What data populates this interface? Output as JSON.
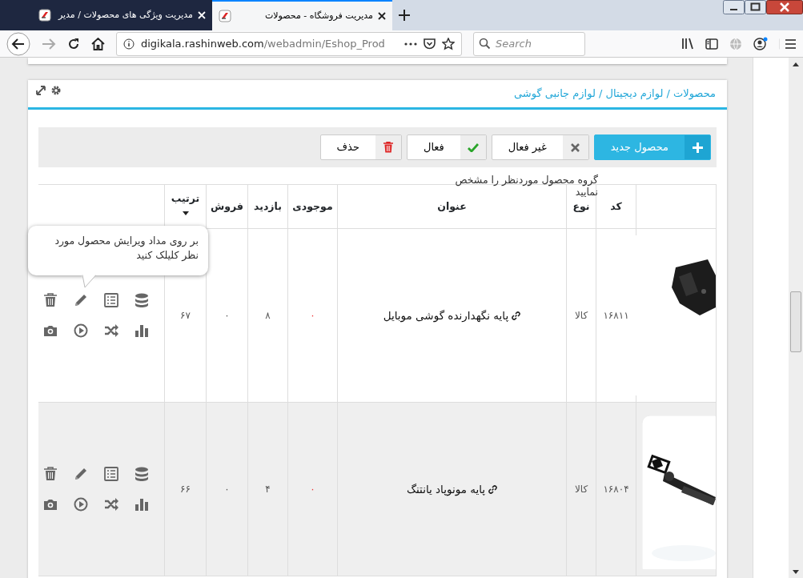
{
  "browser": {
    "tabs": [
      {
        "title": "مدیریت فروشگاه - محصولات",
        "selected": true
      },
      {
        "title": "مدیریت ویژگی های محصولات / مدیر",
        "selected": false
      }
    ],
    "url": {
      "host": "digikala.rashinweb.com",
      "path": "/webadmin/Eshop_Prod"
    },
    "search": {
      "placeholder": "Search"
    }
  },
  "breadcrumb": "محصولات / لوازم دیجیتال / لوازم جانبی گوشی",
  "toolbar": [
    {
      "label": "محصول جدید",
      "kind": "add"
    },
    {
      "label": "غیر فعال",
      "kind": "deactivate"
    },
    {
      "label": "فعال",
      "kind": "activate"
    },
    {
      "label": "حذف",
      "kind": "delete"
    }
  ],
  "hint": "گروه محصول موردنظر را مشخص نمایید",
  "table": {
    "columns": [
      {
        "label": "کد",
        "sorted": false
      },
      {
        "label": "نوع",
        "sorted": false
      },
      {
        "label": "عنوان",
        "sorted": false
      },
      {
        "label": "موجودی",
        "sorted": false
      },
      {
        "label": "بازدید",
        "sorted": false
      },
      {
        "label": "فروش",
        "sorted": false
      },
      {
        "label": "ترتیب",
        "sorted": true
      }
    ],
    "rows": [
      {
        "code": "۱۶۸۱۱",
        "type": "کالا",
        "title": "پایه نگهدارنده گوشی موبایل",
        "stock": "۰",
        "visits": "۸",
        "sales": "۰",
        "order": "۶۷",
        "highlighted": false
      },
      {
        "code": "۱۶۸۰۴",
        "type": "کالا",
        "title": "پایه مونوپاد یانتنگ",
        "stock": "۰",
        "visits": "۴",
        "sales": "۰",
        "order": "۶۶",
        "highlighted": true
      }
    ]
  },
  "tooltip": "بر روی مداد ویرایش محصول مورد نظر کلیلک کنید"
}
